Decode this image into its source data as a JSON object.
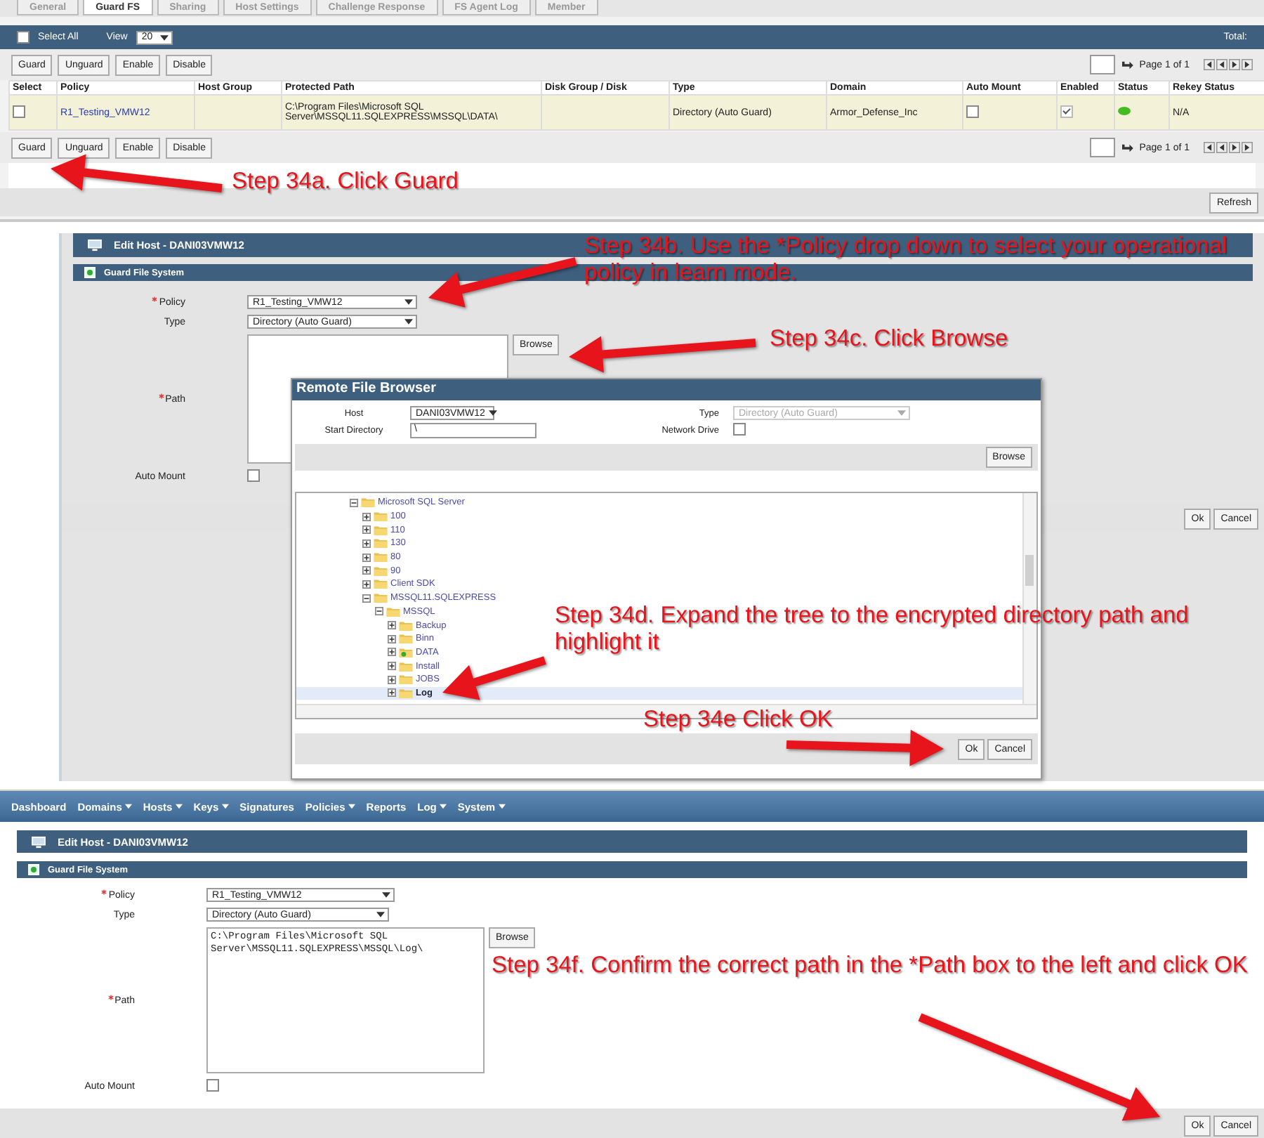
{
  "host_list": {
    "tabs": [
      {
        "label": "General",
        "selected": false
      },
      {
        "label": "Guard FS",
        "selected": true
      },
      {
        "label": "Sharing",
        "selected": false
      },
      {
        "label": "Host Settings",
        "selected": false
      },
      {
        "label": "Challenge Response",
        "selected": false
      },
      {
        "label": "FS Agent Log",
        "selected": false
      },
      {
        "label": "Member",
        "selected": false
      }
    ],
    "select_all": {
      "label": "Select All",
      "checked": false
    },
    "view_label": "View",
    "view_value": "20",
    "total": "Total:",
    "top_buttons": [
      "Guard",
      "Unguard",
      "Enable",
      "Disable"
    ],
    "top_page": "Page 1 of 1",
    "columns": [
      "Select",
      "Policy",
      "Host Group",
      "Protected Path",
      "Disk Group / Disk",
      "Type",
      "Domain",
      "Auto Mount",
      "Enabled",
      "Status",
      "Rekey Status"
    ],
    "rows": [
      {
        "selected": false,
        "policy": "R1_Testing_VMW12",
        "protected_path": "C:\\Program Files\\Microsoft SQL Server\\MSSQL11.SQLEXPRESS\\MSSQL\\DATA\\",
        "type": "Directory (Auto Guard)",
        "domain": "Armor_Defense_Inc",
        "auto_mount": false,
        "enabled": true,
        "color": "#44bb22",
        "rekey_status": "N/A"
      }
    ],
    "bottom_buttons": [
      "Guard",
      "Unguard",
      "Enable",
      "Disable"
    ],
    "bottom_page": "Page 1 of 1",
    "refresh": "Refresh"
  },
  "guard_panel": {
    "title": "Edit Host - DANI03VMW12",
    "section": "Guard File System",
    "policy": {
      "label": "Policy",
      "required": true,
      "value": "R1_Testing_VMW12"
    },
    "type": {
      "label": "Type",
      "required": false,
      "value": "Directory (Auto Guard)"
    },
    "path": {
      "label": "Path",
      "required": true
    },
    "browse": "Browse",
    "auto_mount": {
      "label": "Auto Mount",
      "checked": false
    },
    "ok": "Ok",
    "cancel": "Cancel"
  },
  "remote_file_browser": {
    "title": "Remote File Browser",
    "host": {
      "label": "Host",
      "value": "DANI03VMW12"
    },
    "type": {
      "label": "Type",
      "value": "Directory (Auto Guard)",
      "disabled": true
    },
    "start_directory": {
      "label": "Start Directory",
      "value": "\\"
    },
    "network_drive": {
      "label": "Network Drive",
      "checked": false
    },
    "browse": "Browse",
    "tree": [
      {
        "name": "Microsoft SQL Server",
        "kind": "folder",
        "expanded": true,
        "selected": false,
        "children": [
          {
            "name": "100",
            "kind": "folder",
            "expanded": false,
            "selected": false
          },
          {
            "name": "110",
            "kind": "folder",
            "expanded": false,
            "selected": false
          },
          {
            "name": "130",
            "kind": "folder",
            "expanded": false,
            "selected": false
          },
          {
            "name": "80",
            "kind": "folder",
            "expanded": false,
            "selected": false
          },
          {
            "name": "90",
            "kind": "folder",
            "expanded": false,
            "selected": false
          },
          {
            "name": "Client SDK",
            "kind": "folder",
            "expanded": false,
            "selected": false
          },
          {
            "name": "MSSQL11.SQLEXPRESS",
            "kind": "folder",
            "expanded": true,
            "selected": false,
            "children": [
              {
                "name": "MSSQL",
                "kind": "folder",
                "expanded": true,
                "selected": false,
                "children": [
                  {
                    "name": "Backup",
                    "kind": "folder",
                    "expanded": false,
                    "selected": false
                  },
                  {
                    "name": "Binn",
                    "kind": "folder",
                    "expanded": false,
                    "selected": false
                  },
                  {
                    "name": "DATA",
                    "kind": "guarded",
                    "expanded": false,
                    "selected": false
                  },
                  {
                    "name": "Install",
                    "kind": "folder",
                    "expanded": false,
                    "selected": false
                  },
                  {
                    "name": "JOBS",
                    "kind": "folder",
                    "expanded": false,
                    "selected": false
                  },
                  {
                    "name": "Log",
                    "kind": "folder",
                    "expanded": false,
                    "selected": true
                  }
                ]
              }
            ]
          }
        ]
      }
    ],
    "ok": "Ok",
    "cancel": "Cancel"
  },
  "edit_panel": {
    "menu": [
      {
        "label": "Dashboard",
        "has_menu": false
      },
      {
        "label": "Domains",
        "has_menu": true
      },
      {
        "label": "Hosts",
        "has_menu": true
      },
      {
        "label": "Keys",
        "has_menu": true
      },
      {
        "label": "Signatures",
        "has_menu": false
      },
      {
        "label": "Policies",
        "has_menu": true
      },
      {
        "label": "Reports",
        "has_menu": false
      },
      {
        "label": "Log",
        "has_menu": true
      },
      {
        "label": "System",
        "has_menu": true
      }
    ],
    "title": "Edit Host - DANI03VMW12",
    "section": "Guard File System",
    "policy": {
      "label": "Policy",
      "required": true,
      "value": "R1_Testing_VMW12"
    },
    "type": {
      "label": "Type",
      "required": false,
      "value": "Directory (Auto Guard)"
    },
    "path": {
      "label": "Path",
      "required": true,
      "value": "C:\\Program Files\\Microsoft SQL Server\\MSSQL11.SQLEXPRESS\\MSSQL\\Log\\"
    },
    "browse": "Browse",
    "auto_mount": {
      "label": "Auto Mount",
      "checked": false
    },
    "ok": "Ok",
    "cancel": "Cancel"
  },
  "annotations": [
    {
      "text": "Step 34a. Click Guard"
    },
    {
      "text": "Step 34b. Use the *Policy drop down to select your operational policy in learn mode."
    },
    {
      "text": "Step 34c. Click Browse"
    },
    {
      "text": "Step 34d. Expand the tree to the encrypted directory path and highlight it"
    },
    {
      "text": "Step 34e Click OK"
    },
    {
      "text": "Step 34f. Confirm the correct path in the *Path box to the left and click OK"
    }
  ]
}
